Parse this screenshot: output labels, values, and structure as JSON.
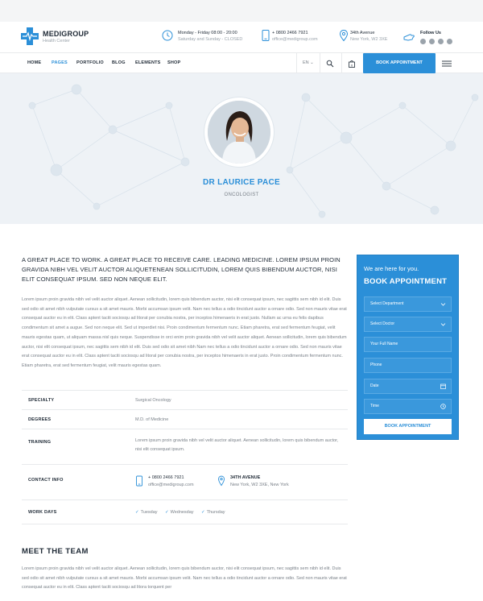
{
  "brand": {
    "name": "MEDIGROUP",
    "tagline": "Health Center"
  },
  "header_info": [
    {
      "icon": "clock-icon",
      "line1": "Monday - Friday 08:00 - 20:00",
      "line2": "Saturday and Sunday - CLOSED"
    },
    {
      "icon": "phone-icon",
      "line1": "+ 0800 2466 7921",
      "line2": "office@medigroup.com"
    },
    {
      "icon": "location-pin-icon",
      "line1": "34th Avenue",
      "line2": "New York, W2 3XE"
    }
  ],
  "follow": {
    "label": "Follow Us",
    "networks": [
      "facebook-icon",
      "twitter-icon",
      "vimeo-icon",
      "linkedin-icon"
    ]
  },
  "nav": {
    "items": [
      "HOME",
      "PAGES",
      "PORTFOLIO",
      "BLOG",
      "ELEMENTS",
      "SHOP"
    ],
    "active": "PAGES",
    "language": "EN",
    "book_label": "BOOK APPOINTMENT"
  },
  "hero": {
    "name": "DR LAURICE PACE",
    "role": "ONCOLOGIST"
  },
  "intro": {
    "lead": "A GREAT PLACE TO WORK. A GREAT PLACE TO RECEIVE CARE. LEADING MEDICINE. LOREM IPSUM PROIN GRAVIDA NIBH VEL VELIT AUCTOR ALIQUETENEAN SOLLICITUDIN, LOREM QUIS BIBENDUM AUCTOR, NISI ELIT CONSEQUAT IPSUM. SED NON NEQUE ELIT.",
    "body": "Lorem ipsum proin gravida nibh vel velit auctor aliquet. Aenean sollicitudin, lorem quis bibendum auctor, nisi elit consequat ipsum, nec sagittis sem nibh id elit. Duis sed odio sit amet nibh vulputate cursus a sit amet mauris. Morbi accumsan ipsum velit. Nam nec tellus a odio tincidunt auctor a ornare odio. Sed non mauris vitae erat consequat auctor eu in elit. Class aptent taciti sociosqu ad litorat per conubia nostra, per inceptos himenaeris in erat justo. Nullam ac urna eu felis dapibus condimentum sit amet a augue. Sed non neque elit. Sed ut imperdiet nisi. Proin condimentum fermentum nunc. Etiam pharetra, erat sed fermentum feugiat, velit mauris egestas quam, ut aliquam massa nisl quis neque. Suspendisse in orci enim proin gravida nibh vel velit auctor aliquet. Aenean sollicitudin, lorem quis bibendum auctor, nisi elit consequat ipsum, nec sagittis sem nibh id elit. Duis sed odio sit amet nibh Nam nec tellus a odio tincidunt auctor a ornare odio. Sed non mauris vitae erat consequat auctor eu in elit. Class aptent taciti sociosqu ad litoral per conubia nostra, per inceptos himenaeris in erat justo. Proin condimentum fermentum nunc. Etiam pharetra, erat sed fermentum feugiat, velit mauris egestas quam."
  },
  "details": {
    "specialty": {
      "label": "SPECIALTY",
      "value": "Surgical Oncology"
    },
    "degrees": {
      "label": "DEGREES",
      "value": "M.D. of Medicine"
    },
    "training": {
      "label": "TRAINING",
      "value": "Lorem ipsum proin gravida nibh vel velit auctor aliquet. Aenean sollicitudin, lorem quis bibendum auctor, nisi elit consequat ipsum."
    },
    "contact": {
      "label": "CONTACT INFO",
      "phone": "+ 0800 2466 7921",
      "email": "office@medigroup.com",
      "street": "34TH AVENUE",
      "city": "New York, W2 3XE, New York"
    },
    "workdays": {
      "label": "WORK DAYS",
      "days": [
        "Tuesday",
        "Wednesday",
        "Thursday"
      ]
    }
  },
  "team": {
    "title": "MEET THE TEAM",
    "text": "Lorem ipsum proin gravida nibh vel velit auctor aliquet. Aenean sollicitudin, lorem quis bibendum auctor, nisi elit consequat ipsum, nec sagittis sem nibh id elit. Duis sed odio sit amet nibh vulputate cursus a sit amet mauris. Morbi accumsan ipsum velit. Nam nec tellus a odio tincidunt auctor a ornare odio. Sed non mauris vitae erat consequat auctor eu in elit. Class aptent taciti sociosqu ad litora torquent per"
  },
  "booking": {
    "intro": "We are here for you.",
    "title": "BOOK APPOINTMENT",
    "fields": [
      "Select Department",
      "Select Doctor",
      "Your Full Name",
      "Phone",
      "Date",
      "Time"
    ],
    "submit": "BOOK APPOINTMENT"
  },
  "colors": {
    "accent": "#2b8fd8",
    "dark": "#1f2a36",
    "muted": "#7a8189"
  }
}
